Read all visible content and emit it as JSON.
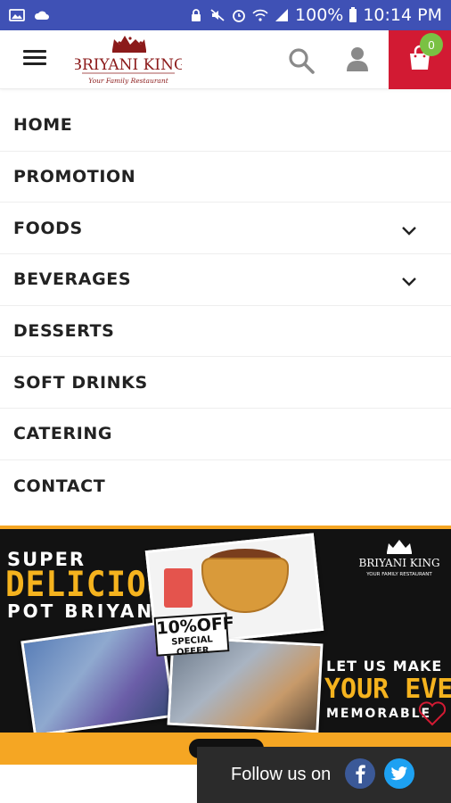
{
  "status_bar": {
    "battery": "100%",
    "time": "10:14 PM"
  },
  "header": {
    "logo_text": "BRIYANI KING",
    "logo_tagline": "Your Family Restaurant",
    "cart_count": "0",
    "colors": {
      "cart_bg": "#d21a33",
      "badge_bg": "#7ac143"
    }
  },
  "menu": {
    "items": [
      {
        "label": "HOME",
        "has_submenu": false
      },
      {
        "label": "PROMOTION",
        "has_submenu": false
      },
      {
        "label": "FOODS",
        "has_submenu": true
      },
      {
        "label": "BEVERAGES",
        "has_submenu": true
      },
      {
        "label": "DESSERTS",
        "has_submenu": false
      },
      {
        "label": "SOFT DRINKS",
        "has_submenu": false
      },
      {
        "label": "CATERING",
        "has_submenu": false
      },
      {
        "label": "CONTACT",
        "has_submenu": false
      }
    ]
  },
  "banner": {
    "line1": "SUPER",
    "line2": "DELICIOUS",
    "line3": "POT BRIYANI",
    "offer_big": "10%OFF",
    "offer_small": "SPECIAL OFFER",
    "event_line1": "LET US MAKE",
    "event_line2": "YOUR EVENT",
    "event_line3": "MEMORABLE",
    "brand": "BRIYANI KING",
    "brand_tagline": "YOUR FAMILY RESTAURANT",
    "colors": {
      "accent": "#f5b31e",
      "background": "#121212"
    }
  },
  "follow": {
    "text": "Follow us on"
  }
}
